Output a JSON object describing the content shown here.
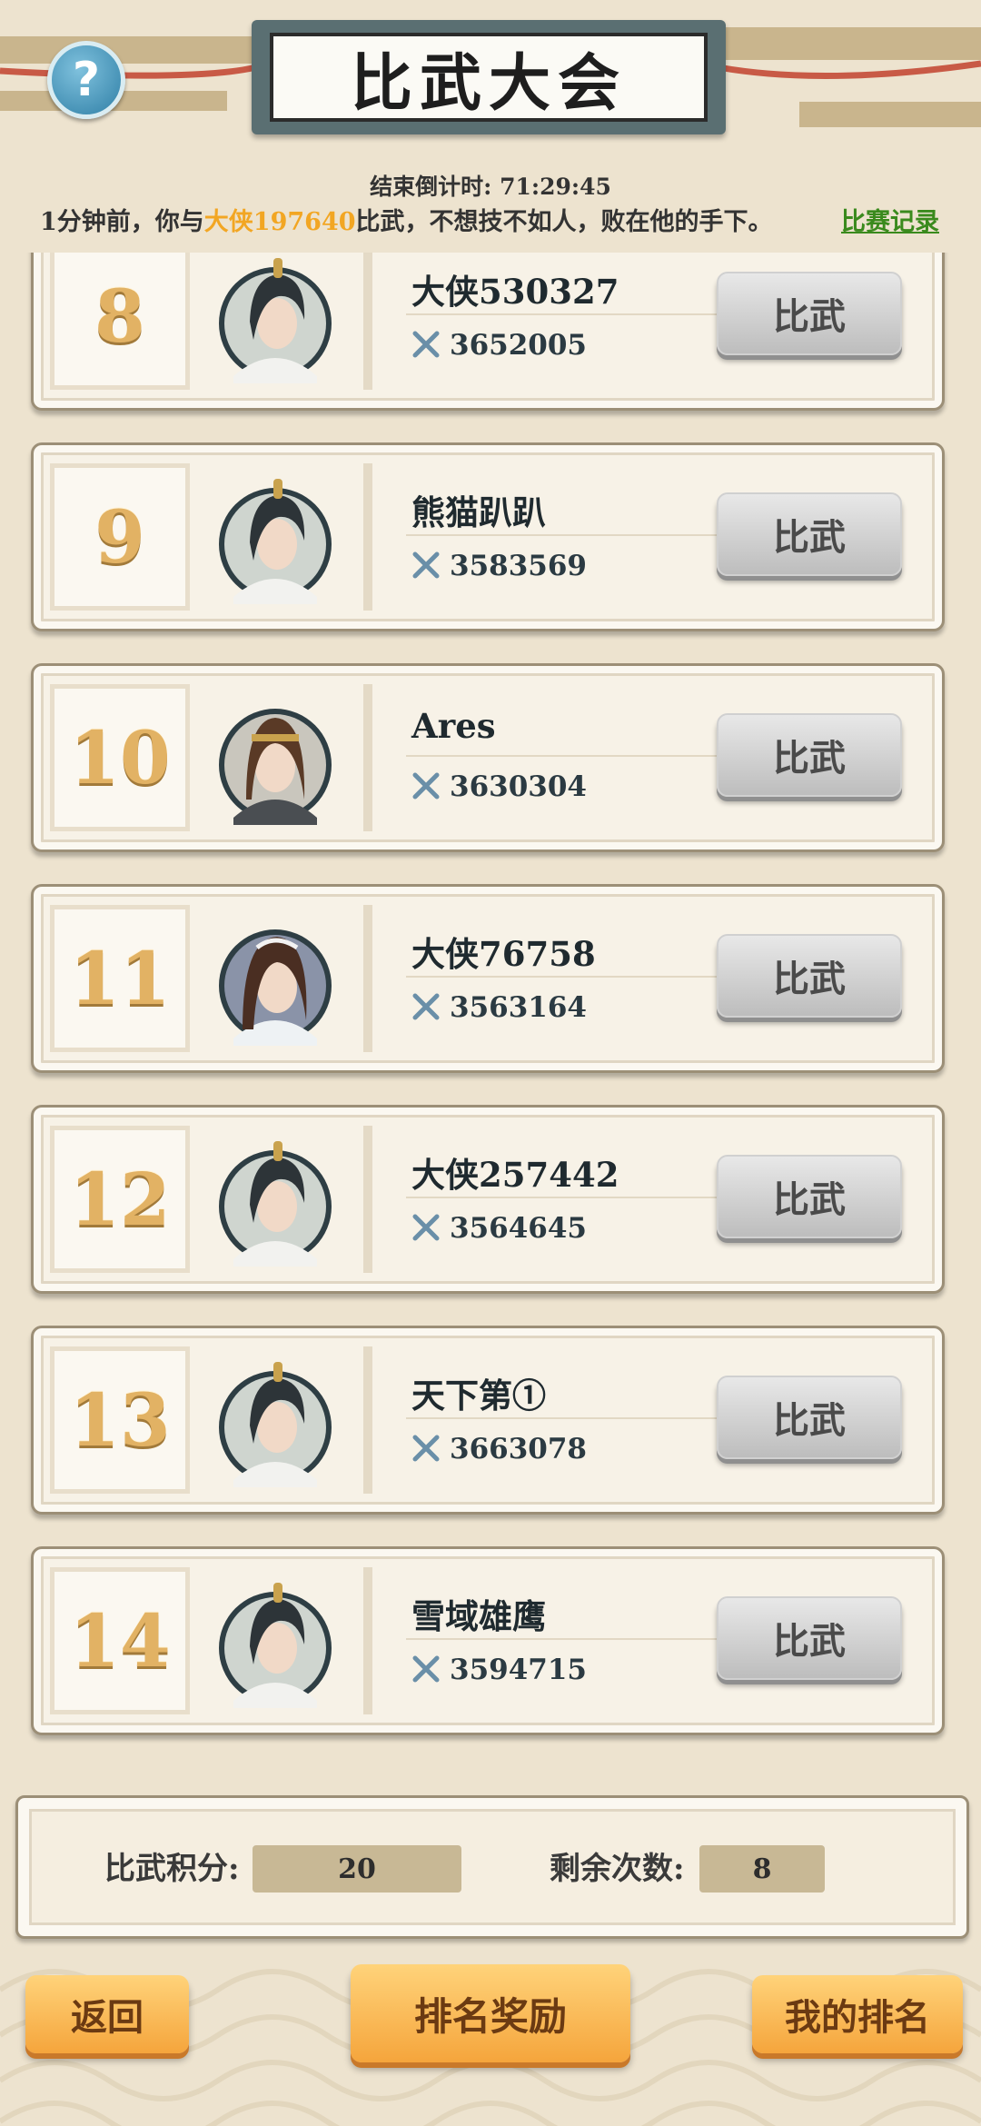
{
  "header": {
    "title": "比武大会",
    "help_icon": "question-icon",
    "countdown_label": "结束倒计时:",
    "countdown_value": "71:29:45"
  },
  "notice": {
    "prefix": "1分钟前，你与",
    "player": "大侠197640",
    "suffix": "比武，不想技不如人，败在他的手下。",
    "record_link": "比赛记录",
    "highlight_color": "#f2a623",
    "link_color": "#3a8a1d"
  },
  "entries": [
    {
      "rank": "8",
      "name": "大侠530327",
      "power": "3652005",
      "button": "比武",
      "avatar": "topknot-swordsman"
    },
    {
      "rank": "9",
      "name": "熊猫趴趴",
      "power": "3583569",
      "button": "比武",
      "avatar": "topknot-swordsman"
    },
    {
      "rank": "10",
      "name": "Ares",
      "power": "3630304",
      "button": "比武",
      "avatar": "headband-warrior"
    },
    {
      "rank": "11",
      "name": "大侠76758",
      "power": "3563164",
      "button": "比武",
      "avatar": "long-hair-hero"
    },
    {
      "rank": "12",
      "name": "大侠257442",
      "power": "3564645",
      "button": "比武",
      "avatar": "topknot-swordsman"
    },
    {
      "rank": "13",
      "name": "天下第①",
      "power": "3663078",
      "button": "比武",
      "avatar": "topknot-swordsman"
    },
    {
      "rank": "14",
      "name": "雪域雄鹰",
      "power": "3594715",
      "button": "比武",
      "avatar": "topknot-swordsman"
    }
  ],
  "stats": {
    "score_label": "比武积分:",
    "score_value": "20",
    "remaining_label": "剩余次数:",
    "remaining_value": "8"
  },
  "footer": {
    "back": "返回",
    "rewards": "排名奖励",
    "my_rank": "我的排名"
  }
}
